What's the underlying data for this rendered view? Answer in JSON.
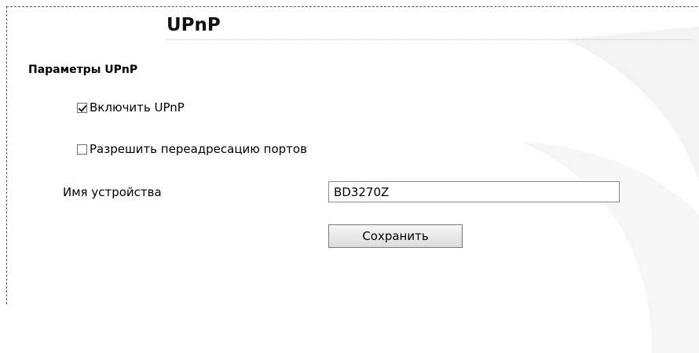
{
  "page": {
    "title": "UPnP"
  },
  "section": {
    "title": "Параметры UPnP"
  },
  "options": [
    {
      "label": "Включить UPnP",
      "checked": true
    },
    {
      "label": "Разрешить переадресацию портов",
      "checked": false
    }
  ],
  "device_name": {
    "label": "Имя устройства",
    "value": "BD3270Z"
  },
  "actions": {
    "save_label": "Сохранить"
  }
}
